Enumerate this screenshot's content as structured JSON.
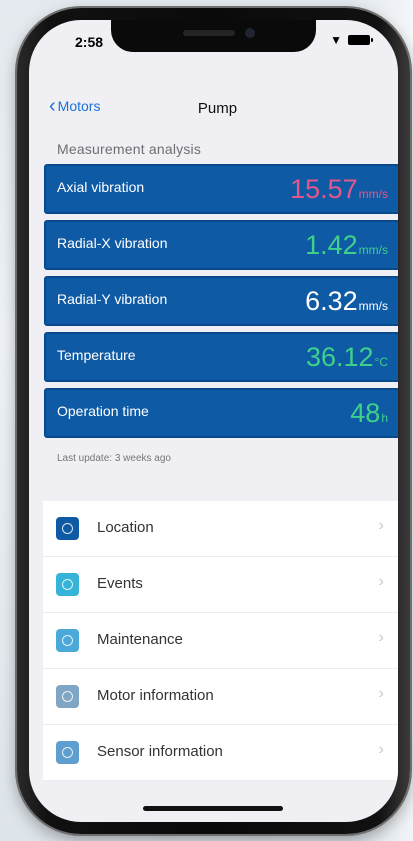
{
  "status": {
    "time": "2:58"
  },
  "nav": {
    "back_label": "Motors",
    "title": "Pump"
  },
  "section_title": "Measurement analysis",
  "measurements": [
    {
      "label": "Axial vibration",
      "value": "15.57",
      "unit": "mm/s",
      "color": "#e5568a"
    },
    {
      "label": "Radial-X vibration",
      "value": "1.42",
      "unit": "mm/s",
      "color": "#3fd08a"
    },
    {
      "label": "Radial-Y vibration",
      "value": "6.32",
      "unit": "mm/s",
      "color": "#ffffff"
    },
    {
      "label": "Temperature",
      "value": "36.12",
      "unit": "°C",
      "color": "#3fd08a"
    },
    {
      "label": "Operation time",
      "value": "48",
      "unit": "h",
      "color": "#3fd08a"
    }
  ],
  "last_update": "Last update: 3 weeks ago",
  "menu": [
    {
      "label": "Location",
      "icon": "location-pin-icon",
      "color": "#0e5aa5"
    },
    {
      "label": "Events",
      "icon": "events-icon",
      "color": "#35b3d8"
    },
    {
      "label": "Maintenance",
      "icon": "maintenance-chart-icon",
      "color": "#4aa9d9"
    },
    {
      "label": "Motor information",
      "icon": "motor-info-icon",
      "color": "#7fa6c4"
    },
    {
      "label": "Sensor information",
      "icon": "sensor-info-icon",
      "color": "#5e9fcf"
    }
  ],
  "chevron": "›"
}
